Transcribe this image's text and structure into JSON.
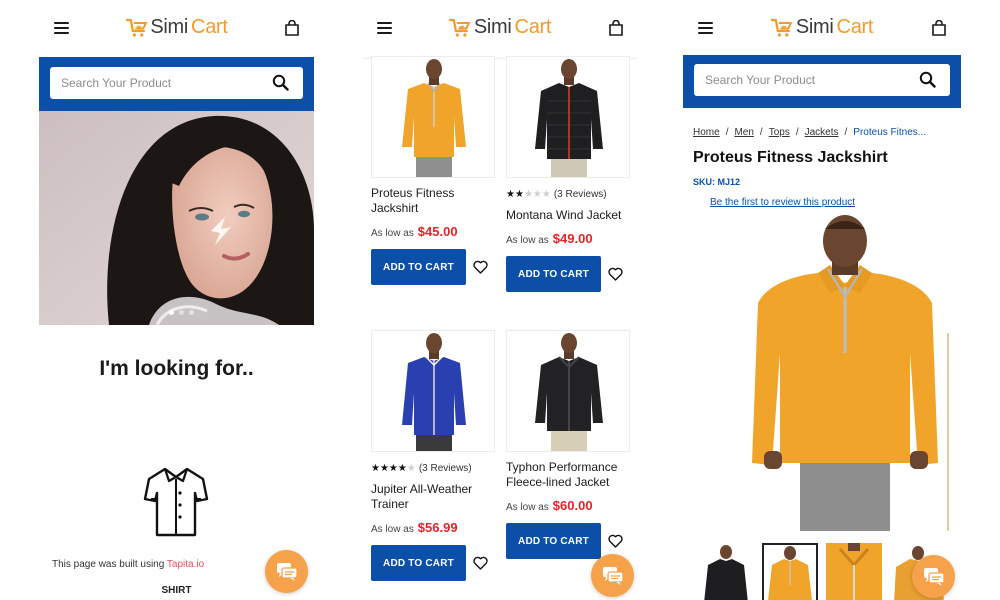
{
  "brand": {
    "name_part1": "Simi",
    "name_part2": "Cart",
    "accent": "#f29a2e",
    "primary": "#0b4fa8",
    "price_color": "#e3232a"
  },
  "icons": [
    "menu-icon",
    "cart-bag-icon",
    "search-icon",
    "shirt-icon",
    "chat-icon",
    "heart-icon",
    "star-icon"
  ],
  "home": {
    "search_placeholder": "Search Your Product",
    "heading": "I'm looking for..",
    "built_prefix": "This page was built using ",
    "built_link": "Tapita.io",
    "category_label": "SHIRT"
  },
  "listing": {
    "products": [
      {
        "name": "Proteus Fitness Jackshirt",
        "price_label": "As low as",
        "price": "$45.00",
        "rating": null,
        "reviews": "",
        "button": "ADD TO CART",
        "color": "orange"
      },
      {
        "name": "Montana Wind Jacket",
        "price_label": "As low as",
        "price": "$49.00",
        "rating": 2.5,
        "reviews": "(3 Reviews)",
        "button": "ADD TO CART",
        "color": "black"
      },
      {
        "name": "Jupiter All-Weather Trainer",
        "price_label": "As low as",
        "price": "$56.99",
        "rating": 4,
        "reviews": "(3 Reviews)",
        "button": "ADD TO CART",
        "color": "blue"
      },
      {
        "name": "Typhon Performance Fleece-lined Jacket",
        "price_label": "As low as",
        "price": "$60.00",
        "rating": null,
        "reviews": "",
        "button": "ADD TO CART",
        "color": "black2"
      }
    ]
  },
  "detail": {
    "search_placeholder": "Search Your Product",
    "breadcrumbs": [
      "Home",
      "Men",
      "Tops",
      "Jackets",
      "Proteus Fitnes..."
    ],
    "product_name": "Proteus Fitness Jackshirt",
    "sku": "SKU: MJ12",
    "review_link": "Be the first to review this product"
  }
}
